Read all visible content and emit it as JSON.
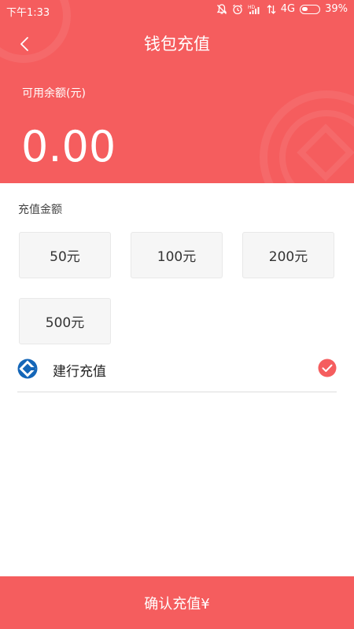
{
  "status_bar": {
    "time": "下午1:33",
    "network": "4G",
    "battery": "39%",
    "battery_level": 0.39
  },
  "header": {
    "title": "钱包充值",
    "back_icon": "chevron-left-icon",
    "balance_label": "可用余额(元)",
    "balance_value": "0.00"
  },
  "recharge": {
    "section_label": "充值金额",
    "amounts": [
      "50元",
      "100元",
      "200元",
      "500元"
    ]
  },
  "payment": {
    "method_label": "建行充值",
    "method_icon": "ccb-bank-icon",
    "selected": true,
    "check_icon": "check-circle-icon"
  },
  "footer": {
    "confirm_label": "确认充值¥"
  },
  "colors": {
    "primary": "#f55d5e",
    "bank_blue": "#1466b8",
    "button_bg": "#f6f6f6"
  }
}
